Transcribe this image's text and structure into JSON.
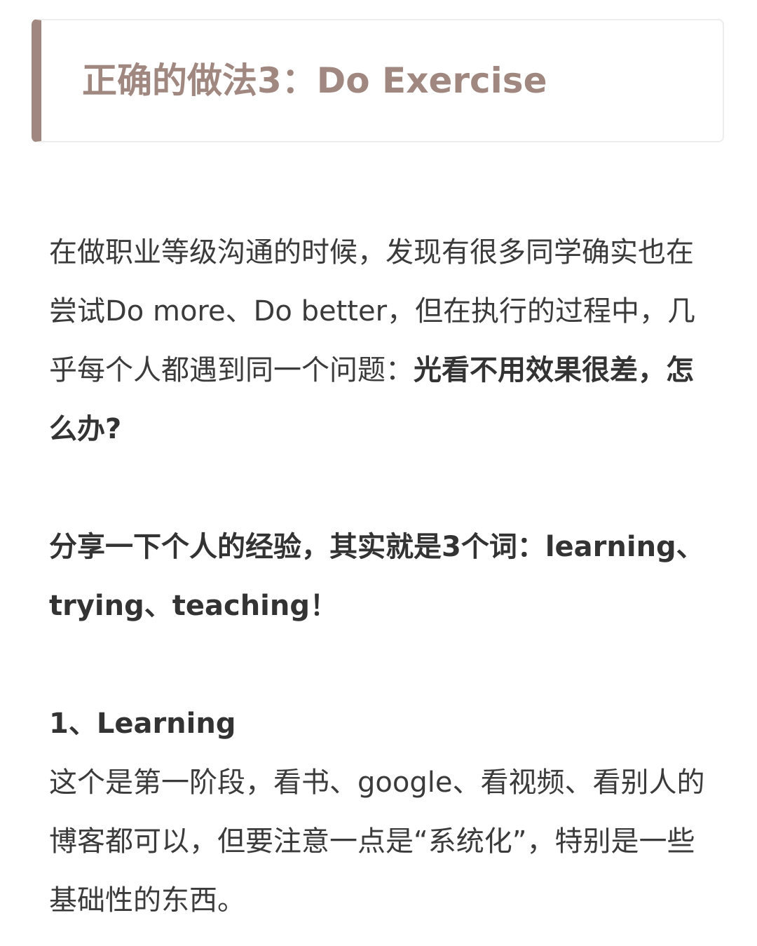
{
  "heading": {
    "title": "正确的做法3：Do Exercise",
    "accent_color": "#a08880"
  },
  "paragraph1": {
    "text": "在做职业等级沟通的时候，发现有很多同学确实也在尝试Do more、Do better，但在执行的过程中，几乎每个人都遇到同一个问题：",
    "bold": "光看不用效果很差，怎么办?"
  },
  "paragraph2": {
    "text": "分享一下个人的经验，其实就是3个词：learning、trying、teaching！"
  },
  "section1": {
    "title": "1、Learning",
    "body": "这个是第一阶段，看书、google、看视频、看别人的博客都可以，但要注意一点是“系统化”，特别是一些基础性的东西。"
  }
}
